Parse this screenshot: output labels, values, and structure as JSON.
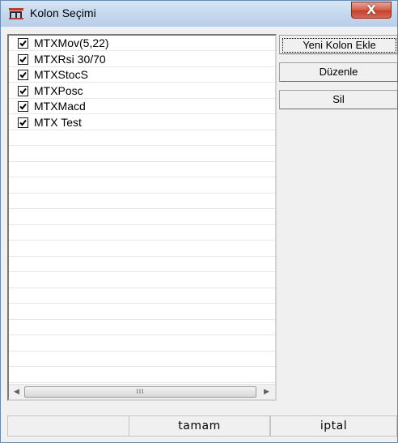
{
  "window": {
    "title": "Kolon Seçimi",
    "icon": "app-m-icon",
    "close_glyph": "X"
  },
  "columns_list": {
    "items": [
      {
        "label": "MTXMov(5,22)",
        "checked": true
      },
      {
        "label": "MTXRsi 30/70",
        "checked": true
      },
      {
        "label": "MTXStocS",
        "checked": true
      },
      {
        "label": "MTXPosc",
        "checked": true
      },
      {
        "label": "MTXMacd",
        "checked": true
      },
      {
        "label": "MTX Test",
        "checked": true
      }
    ],
    "scrollbar": {
      "left_arrow": "◀",
      "right_arrow": "▶",
      "grip": "III"
    }
  },
  "side_buttons": {
    "add_column": "Yeni Kolon Ekle",
    "edit": "Düzenle",
    "delete": "Sil"
  },
  "footer": {
    "ok": "tamam",
    "cancel": "iptal"
  },
  "colors": {
    "title_gradient_top": "#d7e6f5",
    "close_red": "#c6412b",
    "panel_bg": "#f0f0f0"
  }
}
